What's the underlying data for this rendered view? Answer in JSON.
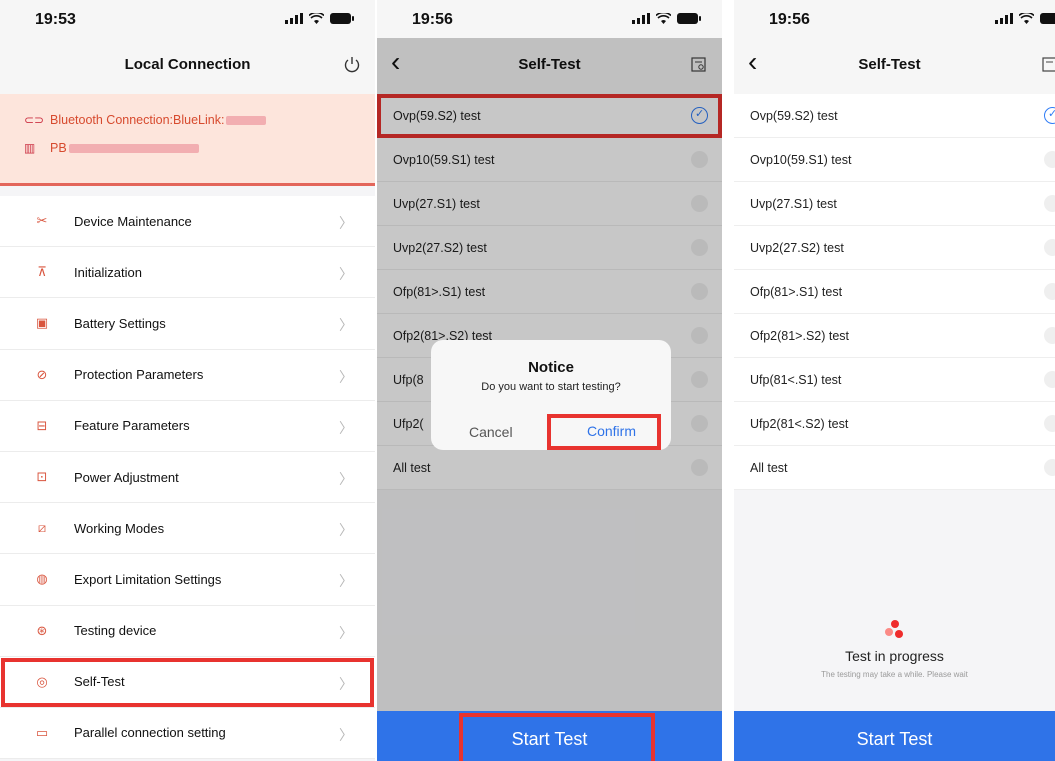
{
  "screen1": {
    "time": "19:53",
    "title": "Local Connection",
    "bluetooth_label": "Bluetooth Connection:BlueLink:",
    "device_label": "PB",
    "menu": [
      {
        "label": "Device Maintenance",
        "icon": "wrench-icon"
      },
      {
        "label": "Initialization",
        "icon": "init-icon"
      },
      {
        "label": "Battery Settings",
        "icon": "battery-icon"
      },
      {
        "label": "Protection Parameters",
        "icon": "protection-icon"
      },
      {
        "label": "Feature Parameters",
        "icon": "feature-icon"
      },
      {
        "label": "Power Adjustment",
        "icon": "power-adjust-icon"
      },
      {
        "label": "Working Modes",
        "icon": "working-modes-icon"
      },
      {
        "label": "Export Limitation Settings",
        "icon": "export-limit-icon"
      },
      {
        "label": "Testing device",
        "icon": "testing-icon"
      },
      {
        "label": "Self-Test",
        "icon": "self-test-icon"
      },
      {
        "label": "Parallel connection setting",
        "icon": "parallel-icon"
      }
    ]
  },
  "screen2": {
    "time": "19:56",
    "title": "Self-Test",
    "tests": [
      "Ovp(59.S2) test",
      "Ovp10(59.S1) test",
      "Uvp(27.S1) test",
      "Uvp2(27.S2) test",
      "Ofp(81>.S1) test",
      "Ofp2(81>.S2) test",
      "Ufp(8",
      "Ufp2(",
      "All test"
    ],
    "dialog": {
      "title": "Notice",
      "message": "Do you want to start testing?",
      "cancel": "Cancel",
      "confirm": "Confirm"
    },
    "start_button": "Start Test"
  },
  "screen3": {
    "time": "19:56",
    "title": "Self-Test",
    "tests": [
      "Ovp(59.S2) test",
      "Ovp10(59.S1) test",
      "Uvp(27.S1) test",
      "Uvp2(27.S2) test",
      "Ofp(81>.S1) test",
      "Ofp2(81>.S2) test",
      "Ufp(81<.S1) test",
      "Ufp2(81<.S2) test",
      "All test"
    ],
    "progress_title": "Test in progress",
    "progress_sub": "The testing may take a while. Please wait",
    "start_button": "Start Test"
  },
  "colors": {
    "accent": "#2f73e8",
    "highlight": "#e8332f",
    "alert_bg": "#fde5dc",
    "alert_text": "#d74a2e"
  }
}
